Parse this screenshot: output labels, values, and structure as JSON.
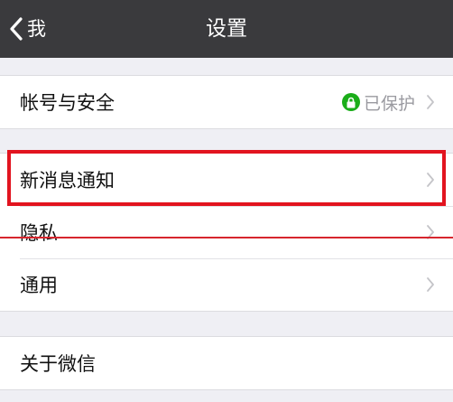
{
  "nav": {
    "back_label": "我",
    "title": "设置"
  },
  "groups": [
    {
      "items": [
        {
          "label": "帐号与安全",
          "status": "已保护",
          "status_icon": "lock-icon"
        }
      ]
    },
    {
      "items": [
        {
          "label": "新消息通知"
        },
        {
          "label": "隐私"
        },
        {
          "label": "通用"
        }
      ]
    },
    {
      "items": [
        {
          "label": "关于微信"
        }
      ]
    }
  ],
  "colors": {
    "navbar": "#3a3a3d",
    "background": "#efeff4",
    "lock_green": "#1aad19",
    "highlight_red": "#e2141f"
  },
  "icons": {
    "back": "chevron-left-icon",
    "row_arrow": "chevron-right-icon",
    "lock": "lock-icon"
  }
}
